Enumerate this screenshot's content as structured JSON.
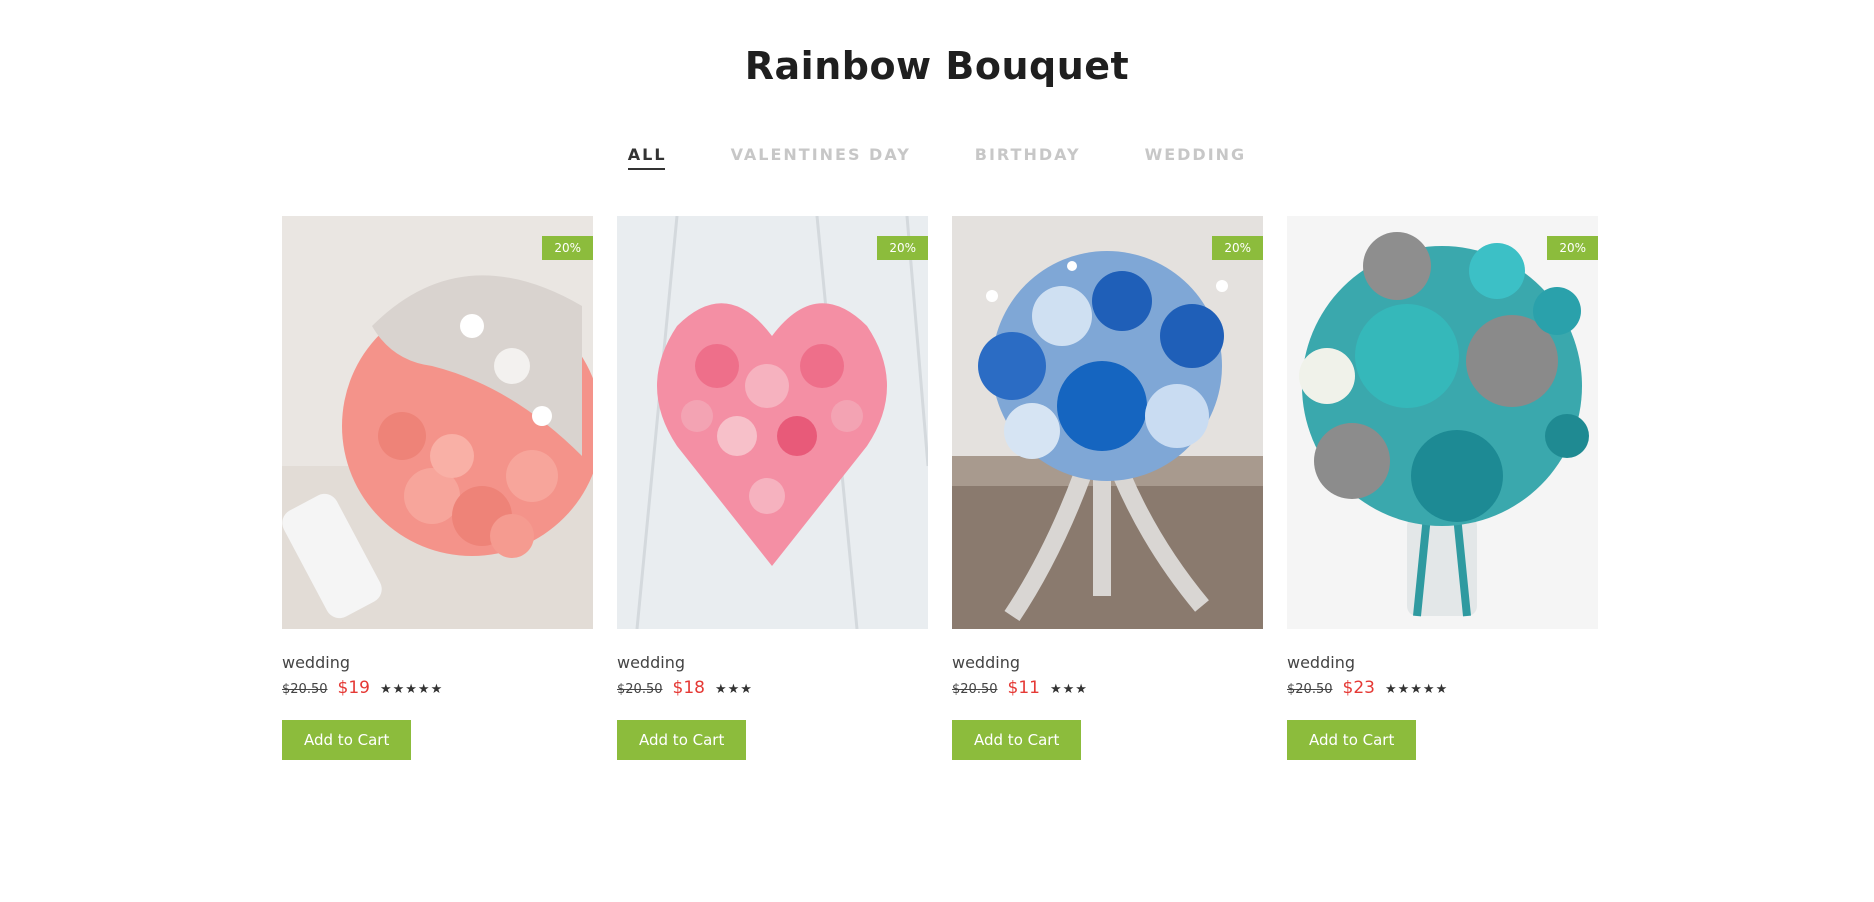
{
  "title": "Rainbow Bouquet",
  "tabs": [
    {
      "label": "ALL",
      "active": true
    },
    {
      "label": "VALENTINES DAY",
      "active": false
    },
    {
      "label": "BIRTHDAY",
      "active": false
    },
    {
      "label": "WEDDING",
      "active": false
    }
  ],
  "products": [
    {
      "image_subject": "pink-rose-crystal-bouquet",
      "badge": "20%",
      "category": "wedding",
      "old_price": "$20.50",
      "price": "$19",
      "stars": "★★★★★",
      "rating": 5,
      "button_label": "Add to Cart"
    },
    {
      "image_subject": "heart-shaped-pink-rose-bouquet",
      "badge": "20%",
      "category": "wedding",
      "old_price": "$20.50",
      "price": "$18",
      "stars": "★★★",
      "rating": 3,
      "button_label": "Add to Cart"
    },
    {
      "image_subject": "blue-rose-ribbon-bouquet",
      "badge": "20%",
      "category": "wedding",
      "old_price": "$20.50",
      "price": "$11",
      "stars": "★★★",
      "rating": 3,
      "button_label": "Add to Cart"
    },
    {
      "image_subject": "teal-gray-rose-bouquet",
      "badge": "20%",
      "category": "wedding",
      "old_price": "$20.50",
      "price": "$23",
      "stars": "★★★★★",
      "rating": 5,
      "button_label": "Add to Cart"
    }
  ],
  "colors": {
    "accent_green": "#8cbc3c",
    "sale_red": "#e53935",
    "tab_inactive": "#c7c7c7",
    "tab_active": "#333333"
  }
}
